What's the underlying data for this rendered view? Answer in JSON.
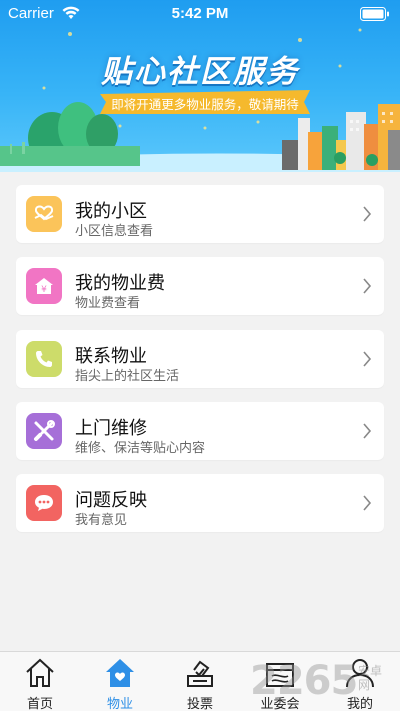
{
  "status_bar": {
    "carrier": "Carrier",
    "time": "5:42 PM"
  },
  "banner": {
    "title": "贴心社区服务",
    "subtitle": "即将开通更多物业服务，敬请期待"
  },
  "menu": [
    {
      "title": "我的小区",
      "desc": "小区信息查看",
      "icon": "heart-hands-icon",
      "color": "#fbc45a"
    },
    {
      "title": "我的物业费",
      "desc": "物业费查看",
      "icon": "house-yen-icon",
      "color": "#f175c4"
    },
    {
      "title": "联系物业",
      "desc": "指尖上的社区生活",
      "icon": "phone-icon",
      "color": "#cddc6a"
    },
    {
      "title": "上门维修",
      "desc": "维修、保洁等贴心内容",
      "icon": "tools-icon",
      "color": "#a66fd8"
    },
    {
      "title": "问题反映",
      "desc": "我有意见",
      "icon": "chat-bubble-icon",
      "color": "#f26461"
    }
  ],
  "tabs": [
    {
      "label": "首页",
      "icon": "home-icon",
      "active": false
    },
    {
      "label": "物业",
      "icon": "property-icon",
      "active": true
    },
    {
      "label": "投票",
      "icon": "vote-icon",
      "active": false
    },
    {
      "label": "业委会",
      "icon": "committee-icon",
      "active": false
    },
    {
      "label": "我的",
      "icon": "user-icon",
      "active": false
    }
  ],
  "colors": {
    "accent": "#2e8fe6",
    "banner_top": "#1f9df0",
    "ribbon": "#f5b92d"
  },
  "watermark": {
    "text": "2265",
    "sub": "安卓网"
  }
}
